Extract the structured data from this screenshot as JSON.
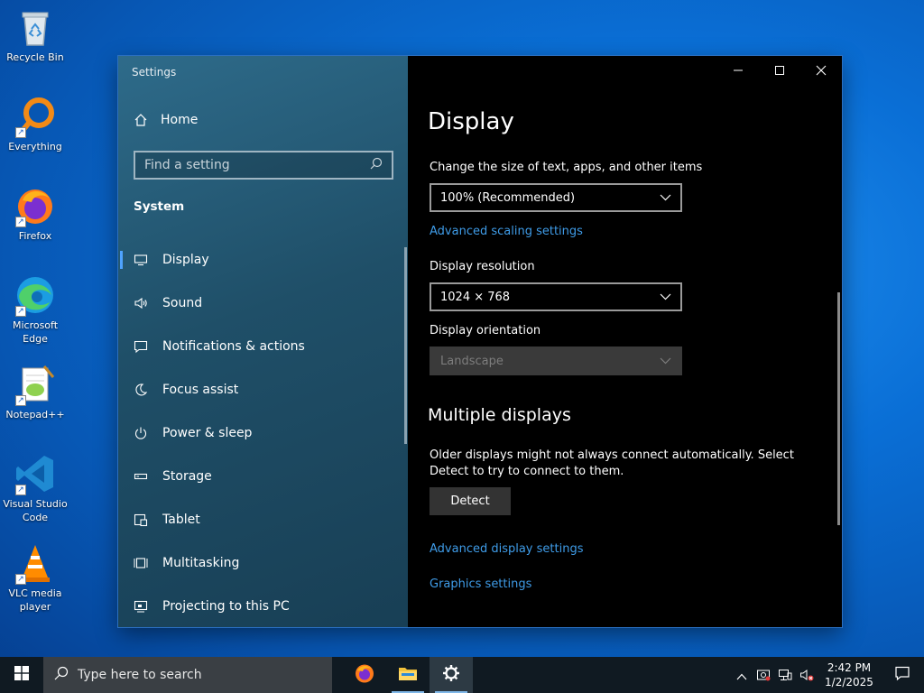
{
  "desktop": {
    "icons": [
      {
        "label": "Recycle Bin",
        "icon": "recycle-bin-icon"
      },
      {
        "label": "Everything",
        "icon": "everything-icon"
      },
      {
        "label": "Firefox",
        "icon": "firefox-icon"
      },
      {
        "label": "Microsoft Edge",
        "icon": "edge-icon"
      },
      {
        "label": "Notepad++",
        "icon": "notepad-plus-plus-icon"
      },
      {
        "label": "Visual Studio Code",
        "icon": "vscode-icon"
      },
      {
        "label": "VLC media player",
        "icon": "vlc-icon"
      }
    ]
  },
  "window": {
    "title": "Settings",
    "controls": {
      "minimize": "–",
      "maximize": "☐",
      "close": "✕"
    }
  },
  "sidebar": {
    "home_label": "Home",
    "search_placeholder": "Find a setting",
    "section": "System",
    "items": [
      {
        "label": "Display",
        "icon": "monitor-icon",
        "active": true
      },
      {
        "label": "Sound",
        "icon": "speaker-icon"
      },
      {
        "label": "Notifications & actions",
        "icon": "notification-icon"
      },
      {
        "label": "Focus assist",
        "icon": "moon-icon"
      },
      {
        "label": "Power & sleep",
        "icon": "power-icon"
      },
      {
        "label": "Storage",
        "icon": "storage-icon"
      },
      {
        "label": "Tablet",
        "icon": "tablet-icon"
      },
      {
        "label": "Multitasking",
        "icon": "multitasking-icon"
      },
      {
        "label": "Projecting to this PC",
        "icon": "projecting-icon"
      }
    ]
  },
  "main": {
    "title": "Display",
    "scale_label": "Change the size of text, apps, and other items",
    "scale_value": "100% (Recommended)",
    "advanced_scaling_link": "Advanced scaling settings",
    "resolution_label": "Display resolution",
    "resolution_value": "1024 × 768",
    "orientation_label": "Display orientation",
    "orientation_value": "Landscape",
    "multiple_heading": "Multiple displays",
    "multiple_desc": "Older displays might not always connect automatically. Select Detect to try to connect to them.",
    "detect_button": "Detect",
    "advanced_display_link": "Advanced display settings",
    "graphics_link": "Graphics settings"
  },
  "taskbar": {
    "search_placeholder": "Type here to search",
    "apps": [
      "firefox-icon",
      "file-explorer-icon",
      "settings-gear-icon"
    ],
    "time": "2:42 PM",
    "date": "1/2/2025"
  },
  "colors": {
    "accent": "#3f9ce8",
    "sidebar_bg": "#1f4f68",
    "content_bg": "#000000",
    "taskbar_bg": "#101a22"
  }
}
